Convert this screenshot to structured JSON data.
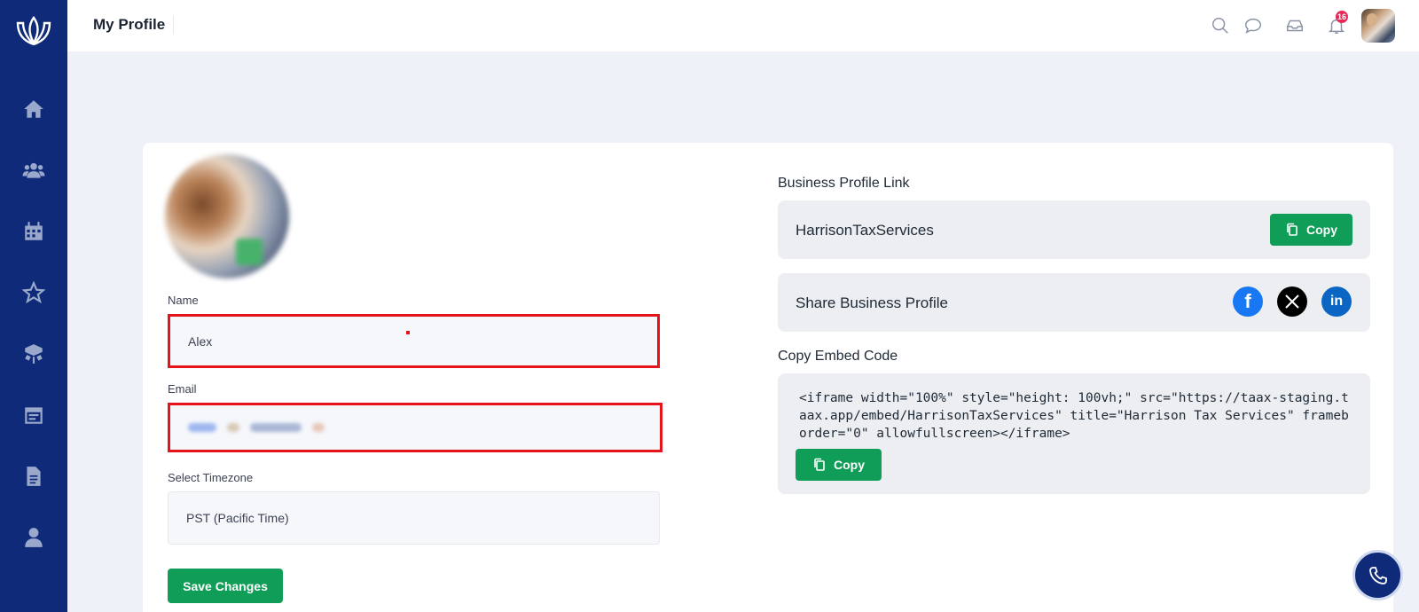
{
  "app": {
    "page_title": "My Profile",
    "notification_count": "16"
  },
  "sidebar": {
    "items": [
      {
        "icon": "home-icon"
      },
      {
        "icon": "users-icon"
      },
      {
        "icon": "calendar-icon"
      },
      {
        "icon": "star-icon"
      },
      {
        "icon": "box-icon"
      },
      {
        "icon": "calendar-list-icon"
      },
      {
        "icon": "document-icon"
      },
      {
        "icon": "user-icon"
      }
    ]
  },
  "profile_form": {
    "name_label": "Name",
    "name_value": "Alex",
    "email_label": "Email",
    "timezone_label": "Select Timezone",
    "timezone_value": "PST (Pacific Time)",
    "save_label": "Save Changes"
  },
  "business": {
    "link_title": "Business Profile Link",
    "link_value": "HarrisonTaxServices",
    "copy_label": "Copy",
    "share_label": "Share Business Profile",
    "embed_title": "Copy Embed Code",
    "embed_code": "<iframe width=\"100%\" style=\"height: 100vh;\" src=\"https://taax-staging.taax.app/embed/HarrisonTaxServices\" title=\"Harrison Tax Services\" frameborder=\"0\" allowfullscreen></iframe>",
    "embed_copy_label": "Copy"
  },
  "colors": {
    "sidebar_bg": "#0e2a78",
    "primary_green": "#0f9d58",
    "highlight_red": "#e5141b",
    "badge_pink": "#e8285a"
  }
}
